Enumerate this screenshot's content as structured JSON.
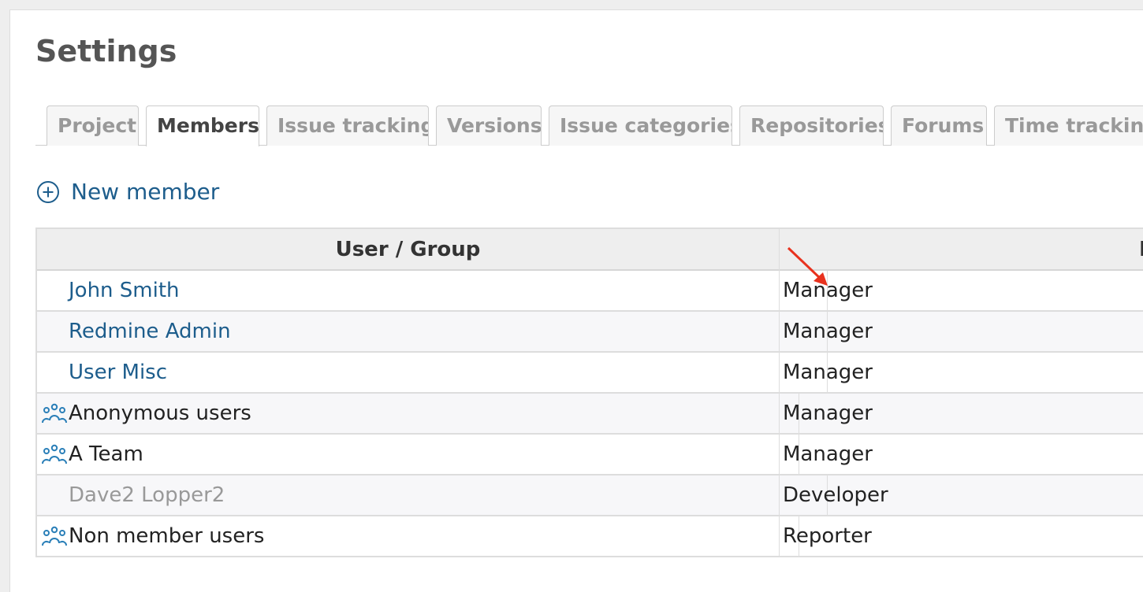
{
  "page": {
    "title": "Settings"
  },
  "tabs": [
    {
      "label": "Project",
      "active": false
    },
    {
      "label": "Members",
      "active": true
    },
    {
      "label": "Issue tracking",
      "active": false
    },
    {
      "label": "Versions",
      "active": false
    },
    {
      "label": "Issue categories",
      "active": false
    },
    {
      "label": "Repositories",
      "active": false
    },
    {
      "label": "Forums",
      "active": false
    },
    {
      "label": "Time tracking",
      "active": false
    }
  ],
  "actions": {
    "new_member": "New member"
  },
  "table": {
    "headers": {
      "user_group": "User / Group",
      "roles": "R"
    },
    "rows": [
      {
        "name": "John Smith",
        "kind": "user",
        "role": "Manager"
      },
      {
        "name": "Redmine Admin",
        "kind": "user",
        "role": "Manager"
      },
      {
        "name": "User Misc",
        "kind": "user",
        "role": "Manager"
      },
      {
        "name": "Anonymous users",
        "kind": "group",
        "role": "Manager"
      },
      {
        "name": "A Team",
        "kind": "group",
        "role": "Manager"
      },
      {
        "name": "Dave2 Lopper2",
        "kind": "locked-user",
        "role": "Developer"
      },
      {
        "name": "Non member users",
        "kind": "group",
        "role": "Reporter"
      }
    ]
  },
  "colors": {
    "link": "#1d5d8c",
    "annotation": "#e8321e",
    "group_icon": "#2a7fb8",
    "locked_text": "#999999"
  },
  "icons": {
    "new_member": "plus-circle-icon",
    "group": "group-icon",
    "annotation": "red-arrow-icon"
  }
}
